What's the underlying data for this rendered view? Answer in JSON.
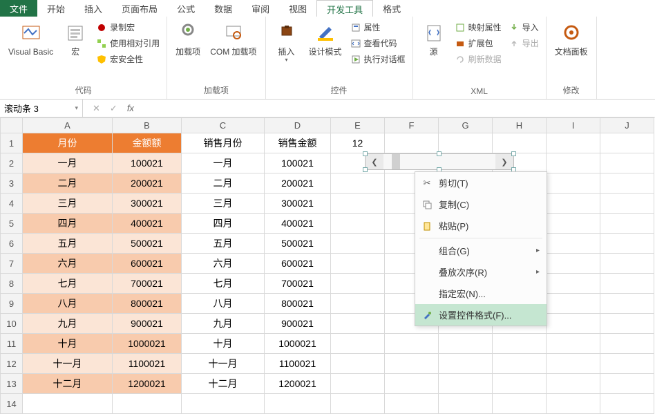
{
  "tabs": {
    "file": "文件",
    "home": "开始",
    "insert": "插入",
    "page_layout": "页面布局",
    "formulas": "公式",
    "data": "数据",
    "review": "审阅",
    "view": "视图",
    "developer": "开发工具",
    "format": "格式"
  },
  "ribbon": {
    "code": {
      "visual_basic": "Visual Basic",
      "macros": "宏",
      "record_macro": "录制宏",
      "use_relative_refs": "使用相对引用",
      "macro_security": "宏安全性",
      "group_label": "代码"
    },
    "addins": {
      "addins": "加载项",
      "com_addins": "COM 加载项",
      "group_label": "加载项"
    },
    "controls": {
      "insert": "插入",
      "design_mode": "设计模式",
      "properties": "属性",
      "view_code": "查看代码",
      "run_dialog": "执行对话框",
      "group_label": "控件"
    },
    "xml": {
      "source": "源",
      "map_properties": "映射属性",
      "expansion_pack": "扩展包",
      "refresh_data": "刷新数据",
      "import": "导入",
      "export": "导出",
      "group_label": "XML"
    },
    "modify": {
      "document_panel": "文档面板",
      "group_label": "修改"
    }
  },
  "formula_bar": {
    "name_box": "滚动条 3",
    "cancel": "✕",
    "confirm": "✓",
    "fx": "fx",
    "value": ""
  },
  "columns": [
    "A",
    "B",
    "C",
    "D",
    "E",
    "F",
    "G",
    "H",
    "I",
    "J"
  ],
  "header_row": {
    "a": "月份",
    "b": "金额额",
    "c": "销售月份",
    "d": "销售金额",
    "e": "12"
  },
  "rows": [
    {
      "a": "一月",
      "b": "100021",
      "c": "一月",
      "d": "100021"
    },
    {
      "a": "二月",
      "b": "200021",
      "c": "二月",
      "d": "200021"
    },
    {
      "a": "三月",
      "b": "300021",
      "c": "三月",
      "d": "300021"
    },
    {
      "a": "四月",
      "b": "400021",
      "c": "四月",
      "d": "400021"
    },
    {
      "a": "五月",
      "b": "500021",
      "c": "五月",
      "d": "500021"
    },
    {
      "a": "六月",
      "b": "600021",
      "c": "六月",
      "d": "600021"
    },
    {
      "a": "七月",
      "b": "700021",
      "c": "七月",
      "d": "700021"
    },
    {
      "a": "八月",
      "b": "800021",
      "c": "八月",
      "d": "800021"
    },
    {
      "a": "九月",
      "b": "900021",
      "c": "九月",
      "d": "900021"
    },
    {
      "a": "十月",
      "b": "1000021",
      "c": "十月",
      "d": "1000021"
    },
    {
      "a": "十一月",
      "b": "1100021",
      "c": "十一月",
      "d": "1100021"
    },
    {
      "a": "十二月",
      "b": "1200021",
      "c": "十二月",
      "d": "1200021"
    }
  ],
  "context_menu": {
    "cut": "剪切(T)",
    "copy": "复制(C)",
    "paste": "粘贴(P)",
    "group": "组合(G)",
    "order": "叠放次序(R)",
    "assign_macro": "指定宏(N)...",
    "format_control": "设置控件格式(F)..."
  }
}
